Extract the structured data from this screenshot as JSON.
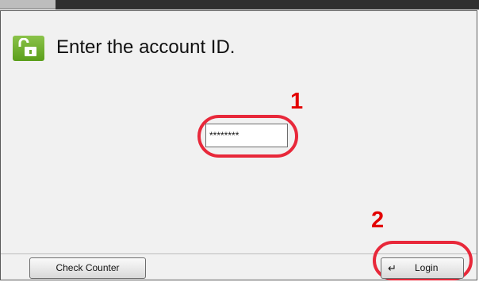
{
  "screen": {
    "title": "Enter the account ID.",
    "icon": "unlock-icon"
  },
  "account_id_field": {
    "value": "********"
  },
  "callouts": {
    "step_1": "1",
    "step_2": "2"
  },
  "footer": {
    "check_counter_label": "Check Counter",
    "login_label": "Login",
    "login_icon": "enter-icon"
  },
  "colors": {
    "accent_green": "#6db32a",
    "callout_red": "#e30000"
  }
}
